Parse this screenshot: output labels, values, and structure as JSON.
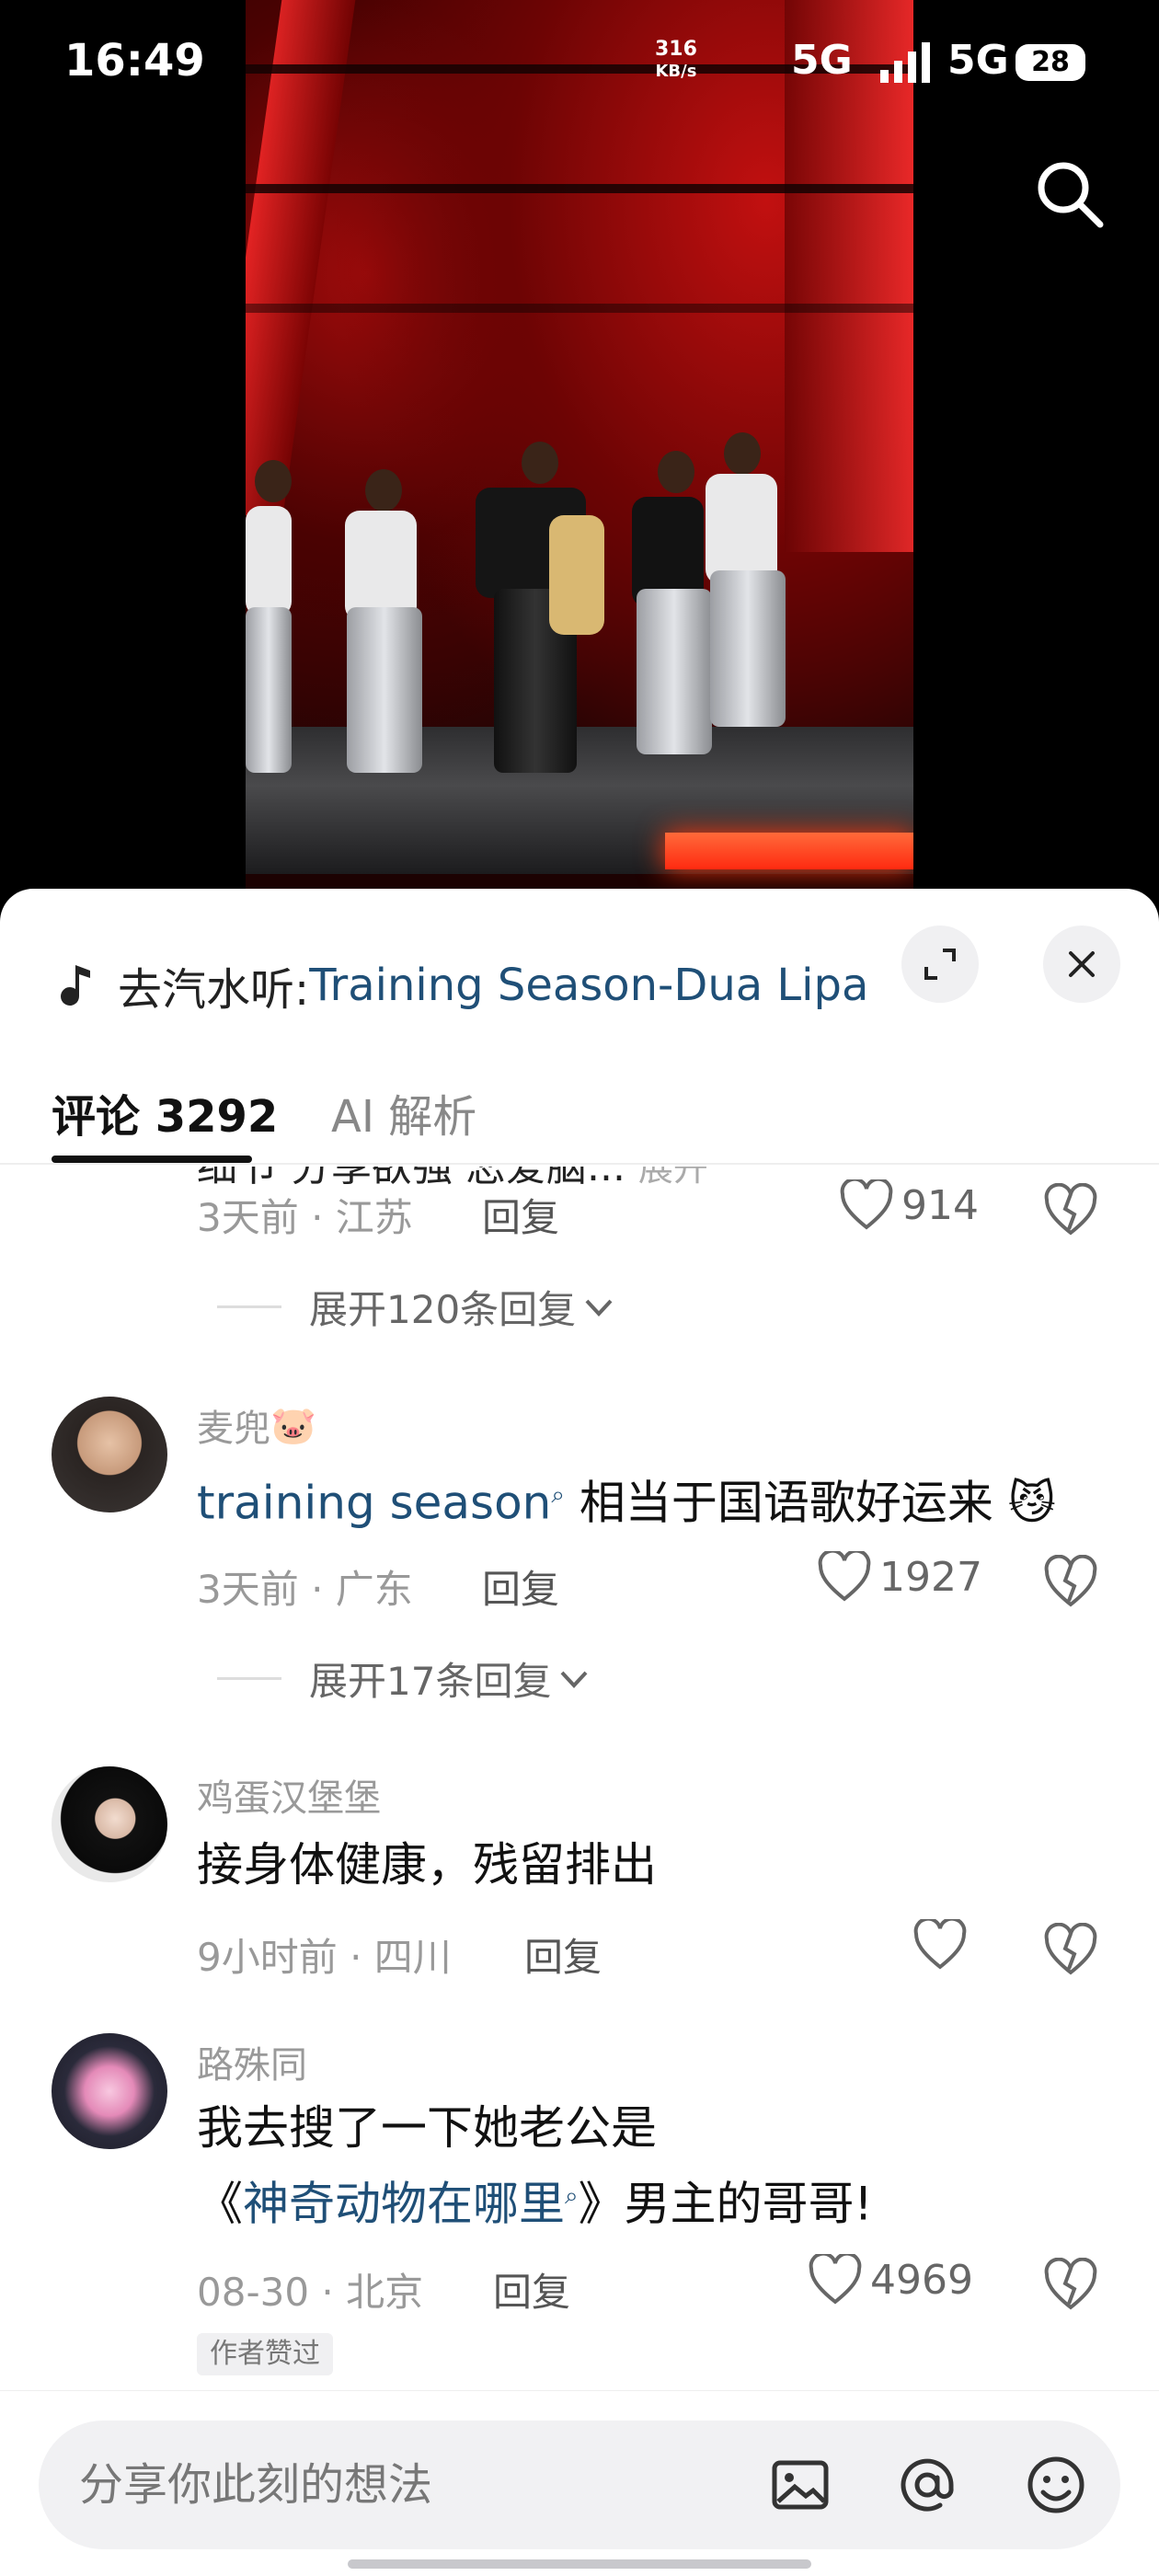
{
  "status_bar": {
    "time": "16:49",
    "speed_value": "316",
    "speed_unit": "KB/s",
    "network_1": "5G",
    "network_2": "5G",
    "battery": "28"
  },
  "music": {
    "prefix": "去汽水听: ",
    "song": "Training Season-Dua Lipa"
  },
  "tabs": {
    "comments": "评论 3292",
    "ai": "AI 解析"
  },
  "cut_comment": {
    "text": "细节 分享欲强 恋爱脑... ",
    "more": "展开",
    "time": "3天前",
    "location": "江苏",
    "reply": "回复",
    "likes": "914",
    "expand_replies": "展开120条回复"
  },
  "comments": [
    {
      "user": "麦兜",
      "emoji": "🐷",
      "text_link": "training season",
      "text_rest": " 相当于国语歌好运来",
      "time": "3天前",
      "location": "广东",
      "reply": "回复",
      "likes": "1927",
      "expand_replies": "展开17条回复"
    },
    {
      "user": "鸡蛋汉堡堡",
      "text": "接身体健康，残留排出",
      "time": "9小时前",
      "location": "四川",
      "reply": "回复",
      "likes": ""
    },
    {
      "user": "路殊同",
      "text_line1": "我去搜了一下她老公是",
      "text_open": "《",
      "text_link": "神奇动物在哪里",
      "text_close": "》男主的哥哥!",
      "time": "08-30",
      "location": "北京",
      "reply": "回复",
      "likes": "4969",
      "badge": "作者赞过"
    }
  ],
  "composer": {
    "placeholder": "分享你此刻的想法"
  },
  "colors": {
    "accent_link": "#1f4f77",
    "muted": "#999999",
    "stage_red": "#c21010"
  },
  "icons": [
    "search-icon",
    "music-note-icon",
    "expand-icon",
    "close-icon",
    "heart-icon",
    "broken-heart-icon",
    "chevron-down-icon",
    "image-icon",
    "at-icon",
    "emoji-icon"
  ]
}
